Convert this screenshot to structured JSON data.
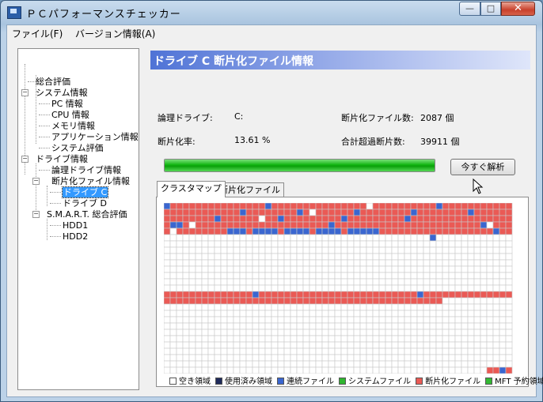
{
  "window": {
    "title": "ＰＣパフォーマンスチェッカー",
    "min": "—",
    "max": "□",
    "close": "✕"
  },
  "menu": [
    "ファイル(F)",
    "バージョン情報(A)"
  ],
  "tree": [
    {
      "label": "総合評価"
    },
    {
      "label": "システム情報"
    },
    {
      "label": "PC 情報"
    },
    {
      "label": "CPU 情報"
    },
    {
      "label": "メモリ情報"
    },
    {
      "label": "アプリケーション情報"
    },
    {
      "label": "システム評価"
    },
    {
      "label": "ドライブ情報"
    },
    {
      "label": "論理ドライブ情報"
    },
    {
      "label": "断片化ファイル情報"
    },
    {
      "label": "ドライブ C"
    },
    {
      "label": "ドライブ D"
    },
    {
      "label": "S.M.A.R.T. 総合評価"
    },
    {
      "label": "HDD1"
    },
    {
      "label": "HDD2"
    }
  ],
  "panel": {
    "banner": "ドライブ C 断片化ファイル情報",
    "logical_drive_label": "論理ドライブ:",
    "logical_drive_value": "C:",
    "frag_files_label": "断片化ファイル数:",
    "frag_files_value": "2087 個",
    "frag_rate_label": "断片化率:",
    "frag_rate_value": "13.61 %",
    "excess_frag_label": "合計超過断片数:",
    "excess_frag_value": "39911 個",
    "progress": 1.0,
    "analyze_button": "今すぐ解析",
    "tabs": [
      "クラスタマップ",
      "断片化ファイル"
    ],
    "legend": [
      {
        "label": "空き領域",
        "color": "#ffffff"
      },
      {
        "label": "使用済み領域",
        "color": "#1f2a5a"
      },
      {
        "label": "連続ファイル",
        "color": "#3a66d0"
      },
      {
        "label": "システムファイル",
        "color": "#2fb52f"
      },
      {
        "label": "断片化ファイル",
        "color": "#ea5a55"
      },
      {
        "label": "MFT 予約領域",
        "color": "#33b833"
      }
    ]
  },
  "colors": {
    "fragmented": "#ea5a55",
    "contiguous": "#3a66d0",
    "free": "#ffffff",
    "grid": "#c8c8c8"
  }
}
